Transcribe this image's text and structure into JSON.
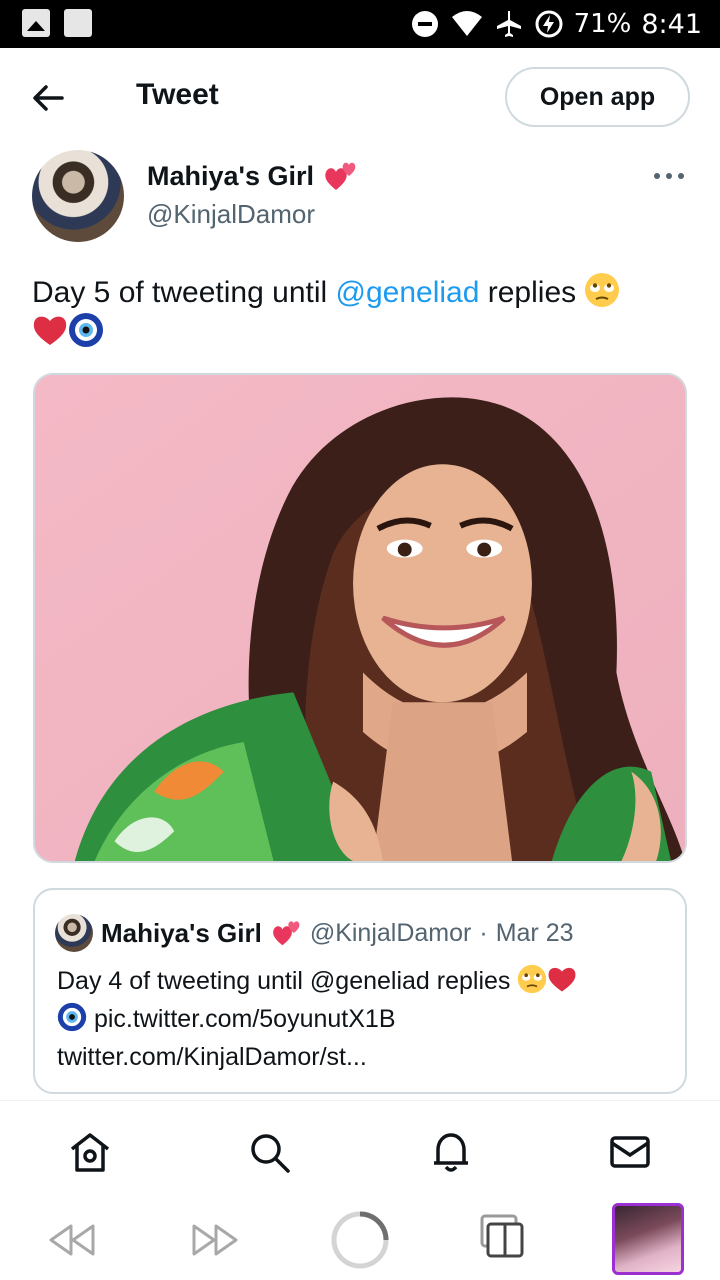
{
  "status_bar": {
    "battery": "71%",
    "time": "8:41"
  },
  "header": {
    "title": "Tweet",
    "open_app": "Open app"
  },
  "tweet": {
    "author_name": "Mahiya's Girl",
    "handle": "@KinjalDamor",
    "text_before": "Day 5 of tweeting until ",
    "mention": "@geneliad",
    "text_after": " replies "
  },
  "quote": {
    "author_name": "Mahiya's Girl",
    "handle": "@KinjalDamor",
    "separator": "·",
    "date": "Mar 23",
    "text_main": "Day 4 of tweeting until @geneliad replies ",
    "link": "pic.twitter.com/5oyunutX1B",
    "url": "twitter.com/KinjalDamor/st..."
  },
  "icons": {
    "status_left": [
      "photo-icon",
      "square-icon"
    ],
    "status_right": [
      "do-not-disturb-icon",
      "wifi-icon",
      "airplane-icon",
      "battery-charging-icon"
    ],
    "nav": [
      "home-icon",
      "search-icon",
      "notifications-icon",
      "messages-icon"
    ],
    "browser": [
      "back-icon",
      "forward-icon",
      "reload-icon",
      "tabs-icon"
    ]
  },
  "colors": {
    "accent": "#1d9bf0",
    "text": "#0f1419",
    "muted": "#536471",
    "border": "#cfd9de"
  }
}
